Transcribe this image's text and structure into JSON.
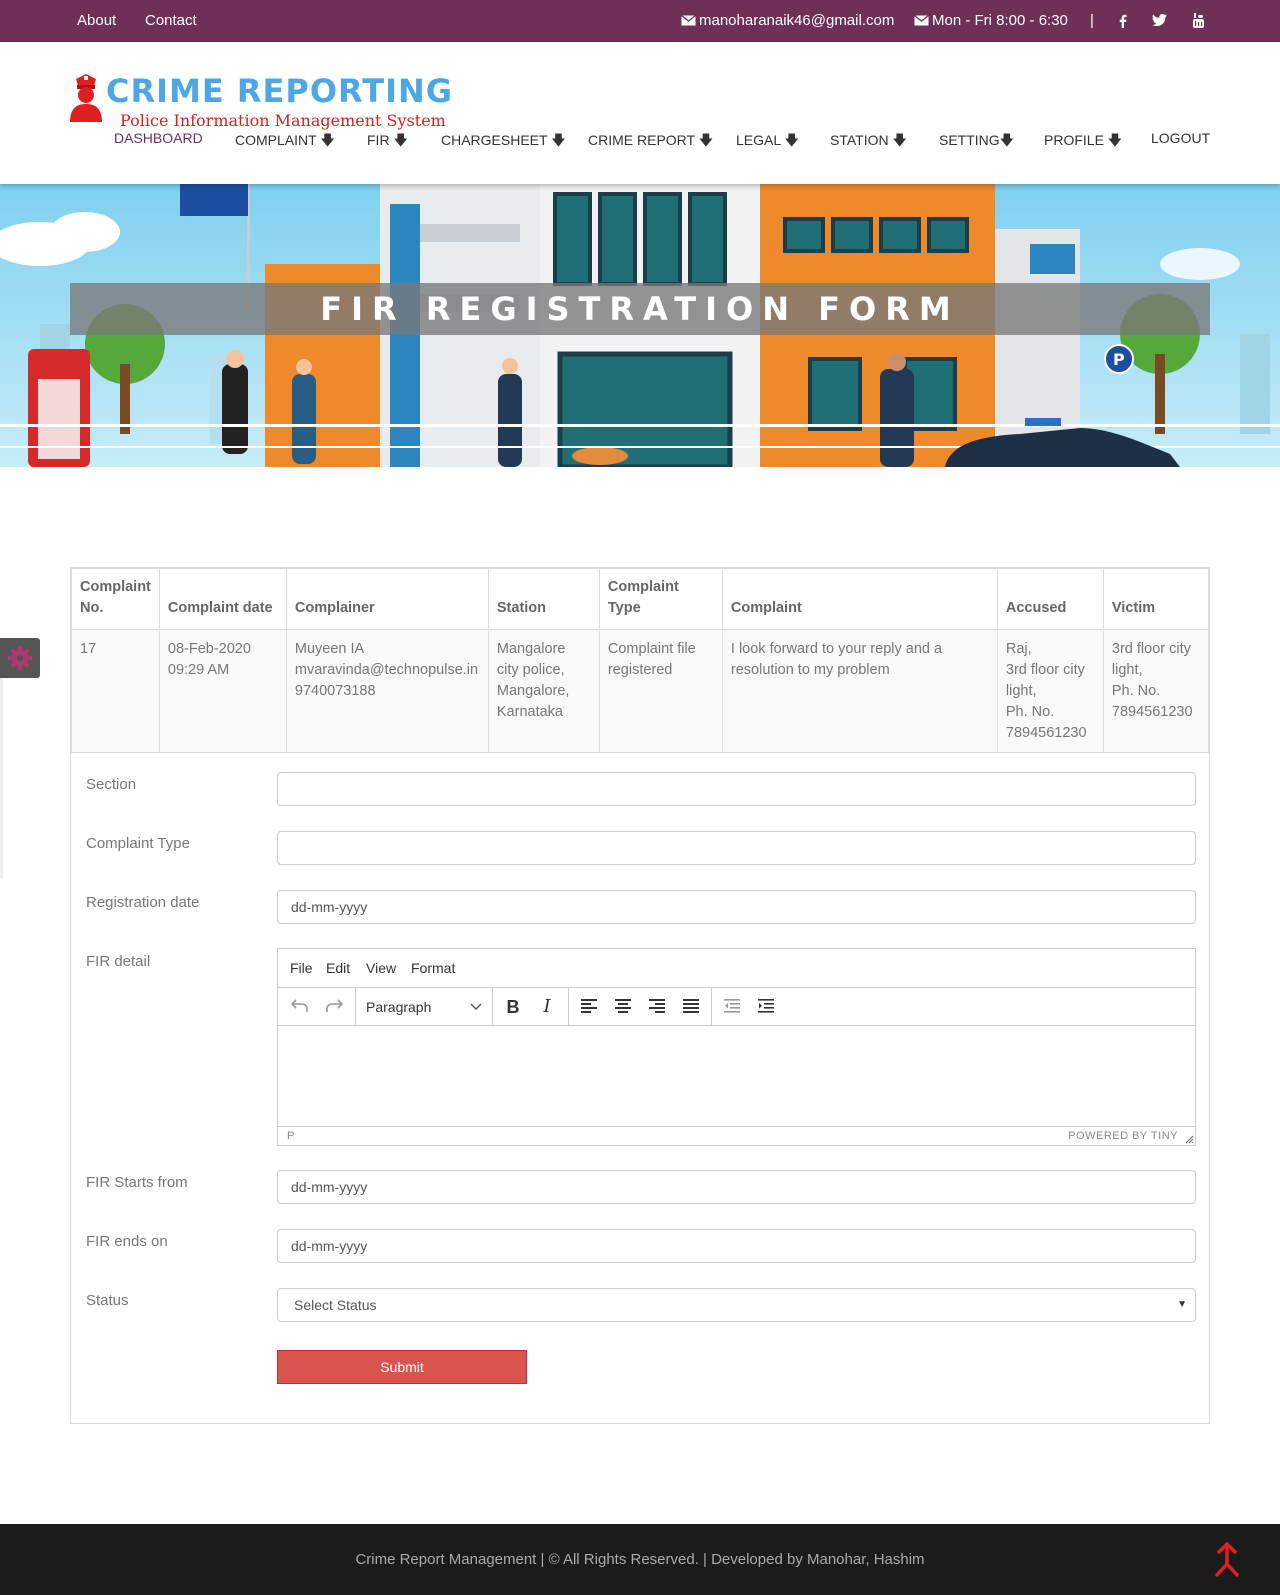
{
  "topbar": {
    "about": "About",
    "contact": "Contact",
    "email": "manoharanaik46@gmail.com",
    "hours": "Mon - Fri 8:00 - 6:30",
    "separator": "|",
    "social_icons": [
      "facebook-icon",
      "twitter-icon",
      "youtube-icon"
    ]
  },
  "logo": {
    "title": "CRIME REPORTING",
    "subtitle": "Police Information Management System"
  },
  "nav": {
    "items": [
      {
        "label": "DASHBOARD"
      },
      {
        "label": "COMPLAINT 🡇"
      },
      {
        "label": "FIR 🡇"
      },
      {
        "label": "CHARGESHEET 🡇"
      },
      {
        "label": "CRIME REPORT 🡇"
      },
      {
        "label": "LEGAL 🡇"
      },
      {
        "label": "STATION 🡇"
      },
      {
        "label": "SETTING🡇"
      },
      {
        "label": "PROFILE 🡇"
      },
      {
        "label": "LOGOUT"
      }
    ]
  },
  "banner": {
    "title": "FIR REGISTRATION FORM"
  },
  "table": {
    "headers": [
      "Complaint No.",
      "Complaint date",
      "Complainer",
      "Station",
      "Complaint Type",
      "Complaint",
      "Accused",
      "Victim"
    ],
    "row": {
      "no": "17",
      "date": [
        "08-Feb-2020",
        "09:29 AM"
      ],
      "complainer": [
        "Muyeen IA",
        "mvaravinda@technopulse.in",
        "9740073188"
      ],
      "station": [
        "Mangalore",
        "city police,",
        "Mangalore,",
        "Karnataka"
      ],
      "type": [
        "Complaint file",
        "registered"
      ],
      "complaint": [
        "I look forward to your reply and a",
        "resolution to my problem"
      ],
      "accused": [
        "Raj,",
        "3rd floor city",
        "light,",
        "Ph. No.",
        "7894561230"
      ],
      "victim": [
        "3rd floor city",
        "light,",
        "Ph. No.",
        "7894561230"
      ]
    }
  },
  "form": {
    "section_label": "Section",
    "section_value": "",
    "complaint_type_label": "Complaint Type",
    "complaint_type_value": "",
    "registration_date_label": "Registration date",
    "registration_date_value": "dd-mm-yyyy",
    "fir_detail_label": "FIR detail",
    "editor": {
      "menu": [
        "File",
        "Edit",
        "View",
        "Format"
      ],
      "block_format": "Paragraph",
      "status_path": "P",
      "powered_by": "POWERED BY TINY"
    },
    "fir_starts_label": "FIR Starts from",
    "fir_starts_value": "dd-mm-yyyy",
    "fir_ends_label": "FIR ends on",
    "fir_ends_value": "dd-mm-yyyy",
    "status_label": "Status",
    "status_value": "Select Status",
    "submit_label": "Submit"
  },
  "footer": {
    "text": "Crime Report Management | © All Rights Reserved. | Developed by Manohar, Hashim"
  },
  "colors": {
    "topbar": "#6f3058",
    "submit": "#d9534f",
    "logo_title": "#4da6e6",
    "logo_subtitle": "#d81e1e",
    "footer": "#1b1b1b"
  }
}
